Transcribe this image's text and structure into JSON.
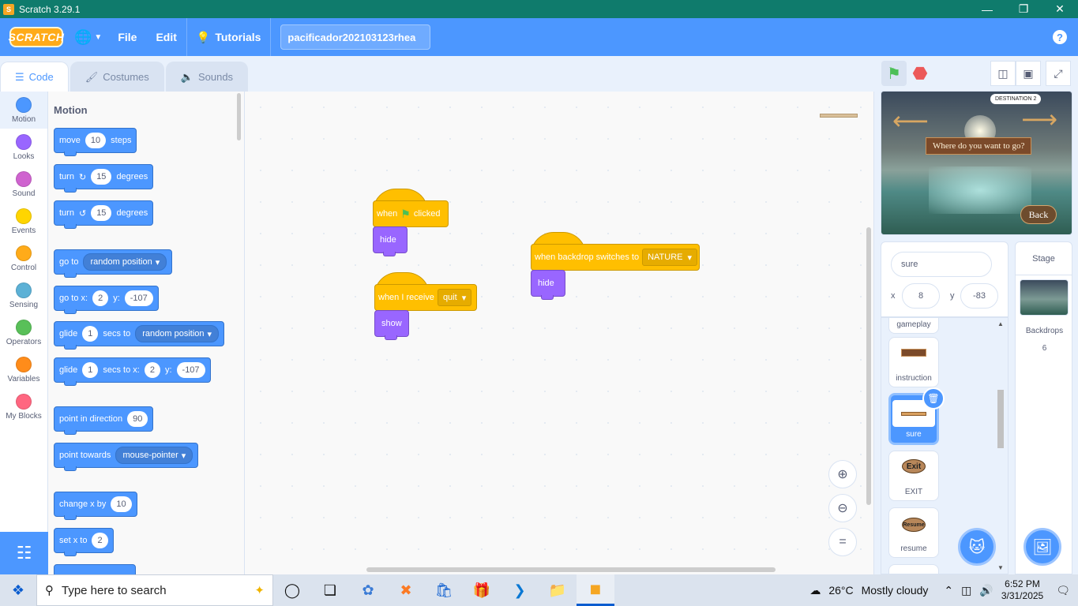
{
  "window": {
    "title": "Scratch 3.29.1",
    "app_icon": "scratch-app-icon",
    "controls": [
      "minimize-icon",
      "restore-icon",
      "close-icon"
    ]
  },
  "menubar": {
    "logo": "SCRATCH",
    "file": "File",
    "edit": "Edit",
    "tutorials": "Tutorials",
    "project_title": "pacificador202103123rhea",
    "accent": "#4c97ff"
  },
  "tabs": [
    {
      "label": "Code",
      "icon": "code-icon",
      "active": true
    },
    {
      "label": "Costumes",
      "icon": "brush-icon",
      "active": false
    },
    {
      "label": "Sounds",
      "icon": "speaker-icon",
      "active": false
    }
  ],
  "categories": [
    {
      "label": "Motion",
      "color": "#4c97ff"
    },
    {
      "label": "Looks",
      "color": "#9966ff"
    },
    {
      "label": "Sound",
      "color": "#cf63cf"
    },
    {
      "label": "Events",
      "color": "#ffd500"
    },
    {
      "label": "Control",
      "color": "#ffab19"
    },
    {
      "label": "Sensing",
      "color": "#5cb1d6"
    },
    {
      "label": "Operators",
      "color": "#59c059"
    },
    {
      "label": "Variables",
      "color": "#ff8c1a"
    },
    {
      "label": "My Blocks",
      "color": "#ff6680"
    }
  ],
  "palette": {
    "heading": "Motion",
    "move": {
      "pre": "move",
      "val": "10",
      "post": "steps"
    },
    "turn_right": {
      "pre": "turn",
      "val": "15",
      "post": "degrees"
    },
    "turn_left": {
      "pre": "turn",
      "val": "15",
      "post": "degrees"
    },
    "goto": {
      "pre": "go to",
      "drop": "random position"
    },
    "goto_xy": {
      "pre": "go to x:",
      "x": "2",
      "ylabel": "y:",
      "y": "-107"
    },
    "glide_to": {
      "pre": "glide",
      "val": "1",
      "mid": "secs to",
      "drop": "random position"
    },
    "glide_xy": {
      "pre": "glide",
      "val": "1",
      "mid": "secs to x:",
      "x": "2",
      "ylabel": "y:",
      "y": "-107"
    },
    "point_dir": {
      "pre": "point in direction",
      "val": "90"
    },
    "point_towards": {
      "pre": "point towards",
      "drop": "mouse-pointer"
    },
    "change_x": {
      "pre": "change x by",
      "val": "10"
    },
    "set_x": {
      "pre": "set x to",
      "val": "2"
    }
  },
  "scripts": {
    "s1": {
      "hat_pre": "when",
      "hat_post": "clicked",
      "block": "hide"
    },
    "s2": {
      "hat_pre": "when I receive",
      "drop": "quit",
      "block": "show"
    },
    "s3": {
      "hat_pre": "when backdrop switches to",
      "drop": "NATURE",
      "block": "hide"
    }
  },
  "stage": {
    "bubble": "DESTINATION 2",
    "question": "Where do you want to go?",
    "back": "Back"
  },
  "sprite_info": {
    "name": "sure",
    "x_label": "x",
    "x": "8",
    "y_label": "y",
    "y": "-83"
  },
  "sprites": [
    {
      "name": "gameplay"
    },
    {
      "name": "instruction"
    },
    {
      "name": "sure",
      "selected": true
    },
    {
      "name": "EXIT",
      "thumb_text": "Exit"
    },
    {
      "name": "resume",
      "thumb_text": "Resume"
    }
  ],
  "stage_target": {
    "header": "Stage",
    "label": "Backdrops",
    "count": "6"
  },
  "taskbar": {
    "search_placeholder": "Type here to search",
    "temperature": "26°C",
    "weather": "Mostly cloudy",
    "time": "6:52 PM",
    "date": "3/31/2025"
  }
}
